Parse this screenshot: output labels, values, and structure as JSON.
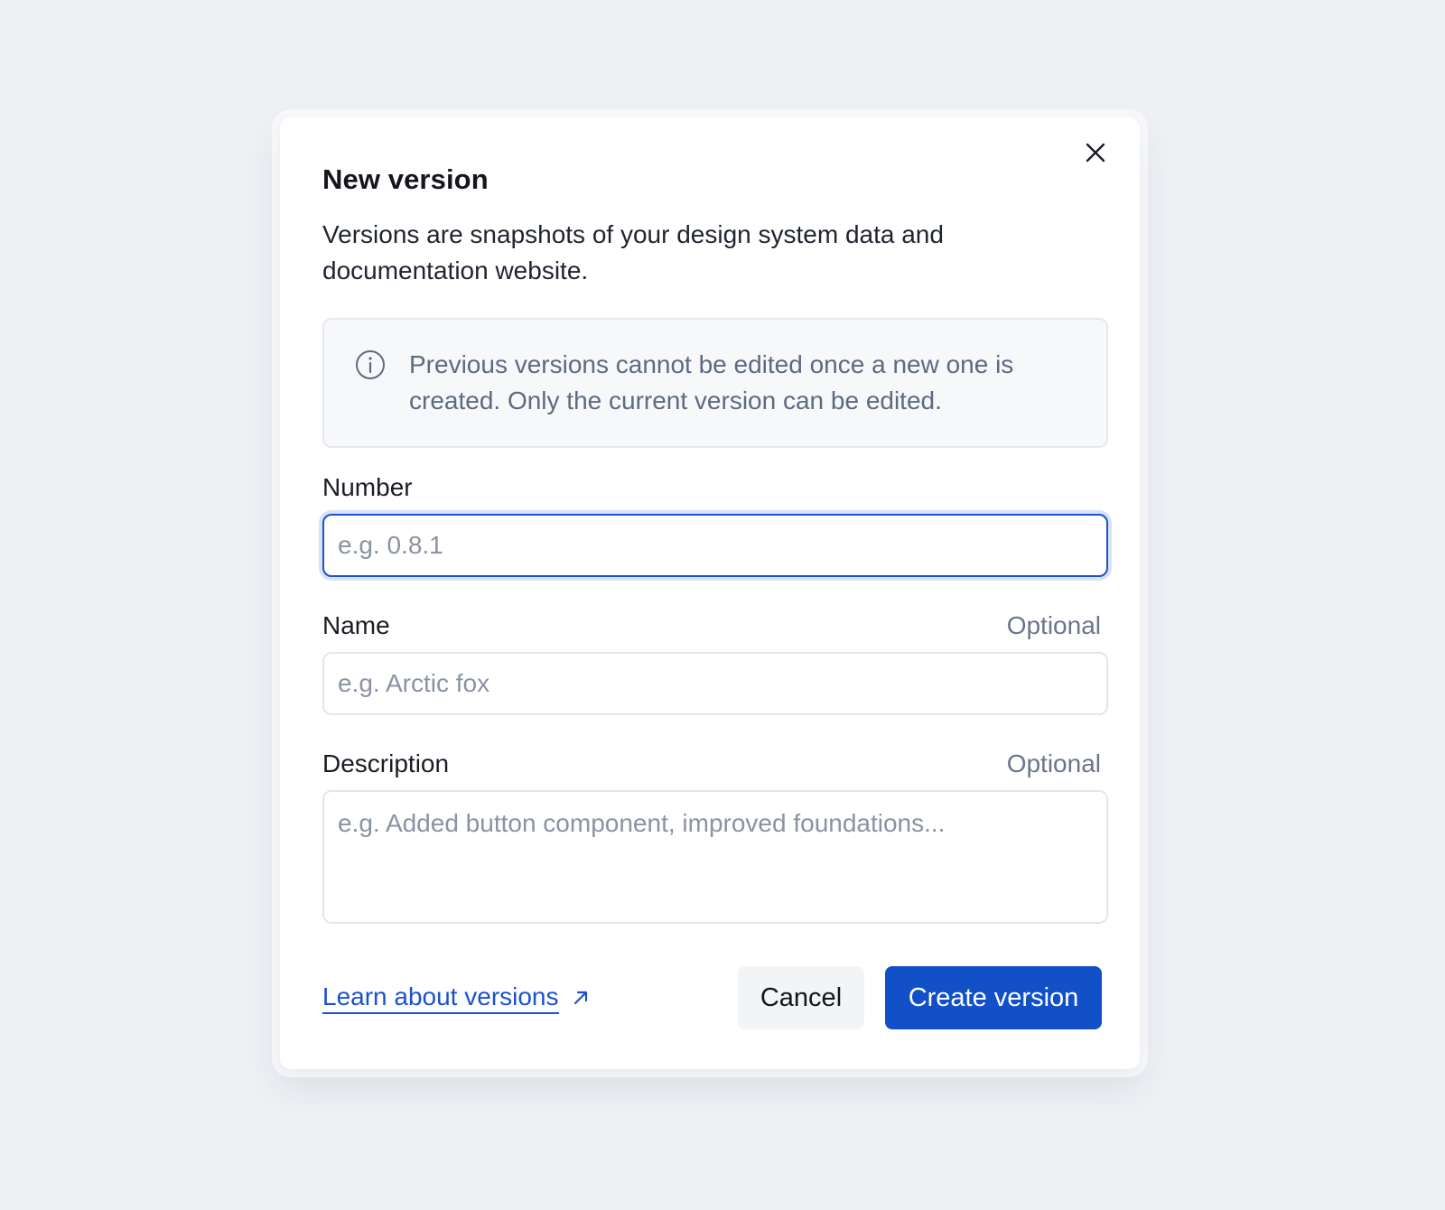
{
  "dialog": {
    "title": "New version",
    "subtitle": "Versions are snapshots of your design system data and documentation website.",
    "info": {
      "icon": "info-circle-icon",
      "text": "Previous versions cannot be edited once a new one is created. Only the current version can be edited."
    },
    "fields": {
      "number": {
        "label": "Number",
        "placeholder": "e.g. 0.8.1",
        "value": ""
      },
      "name": {
        "label": "Name",
        "optional_label": "Optional",
        "placeholder": "e.g. Arctic fox",
        "value": ""
      },
      "description": {
        "label": "Description",
        "optional_label": "Optional",
        "placeholder": "e.g. Added button component, improved foundations...",
        "value": ""
      }
    },
    "footer": {
      "learn_link": "Learn about versions",
      "cancel_label": "Cancel",
      "create_label": "Create version"
    }
  },
  "colors": {
    "background": "#eef0f4",
    "primary": "#1250c8",
    "link": "#1a53cc",
    "info_text": "#5e6a80",
    "muted": "#6b7589"
  },
  "icons": {
    "close": "close-icon",
    "info": "info-circle-icon",
    "external_link": "arrow-up-right-icon"
  }
}
